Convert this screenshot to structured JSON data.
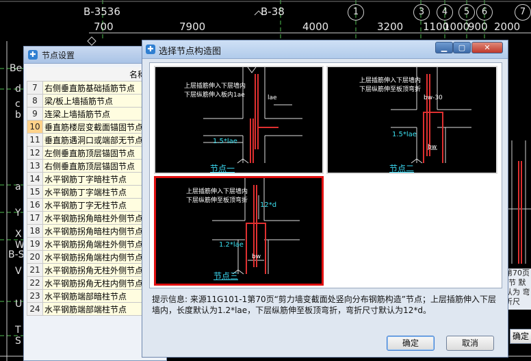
{
  "cad": {
    "axis_top": [
      "B-3536",
      "B-38",
      "1",
      "3",
      "4",
      "5",
      "6",
      "7"
    ],
    "dims": [
      "700",
      "7900",
      "4000",
      "3200",
      "1100",
      "1000",
      "900",
      "2000"
    ],
    "left_tags": [
      "Be",
      "d",
      "c",
      "b",
      "a",
      "Y",
      "X",
      "W",
      "B-S",
      "V",
      "U",
      "T",
      "S"
    ]
  },
  "node_window": {
    "title": "节点设置",
    "header": "名称",
    "rows": [
      {
        "num": "7",
        "name": "右侧垂直筋基础插筋节点"
      },
      {
        "num": "8",
        "name": "梁/板上墙插筋节点"
      },
      {
        "num": "9",
        "name": "连梁上墙插筋节点"
      },
      {
        "num": "10",
        "name": "垂直筋楼层变截面锚固节点"
      },
      {
        "num": "11",
        "name": "垂直筋遇洞口或端部无节点"
      },
      {
        "num": "12",
        "name": "左侧垂直筋顶层锚固节点"
      },
      {
        "num": "13",
        "name": "右侧垂直筋顶层锚固节点"
      },
      {
        "num": "14",
        "name": "水平钢筋丁字暗柱节点"
      },
      {
        "num": "15",
        "name": "水平钢筋丁字端柱节点"
      },
      {
        "num": "16",
        "name": "水平钢筋丁字无柱节点"
      },
      {
        "num": "17",
        "name": "水平钢筋拐角暗柱外侧节点"
      },
      {
        "num": "18",
        "name": "水平钢筋拐角暗柱内侧节点"
      },
      {
        "num": "19",
        "name": "水平钢筋拐角端柱外侧节点"
      },
      {
        "num": "20",
        "name": "水平钢筋拐角端柱内侧节点"
      },
      {
        "num": "21",
        "name": "水平钢筋拐角无柱外侧节点"
      },
      {
        "num": "22",
        "name": "水平钢筋拐角无柱内侧节点"
      },
      {
        "num": "23",
        "name": "水平钢筋端部暗柱节点"
      },
      {
        "num": "24",
        "name": "水平钢筋端部端柱节点"
      }
    ]
  },
  "dialog": {
    "title": "选择节点构造图",
    "nodes": [
      {
        "label": "节点一",
        "note1": "上层插筋伸入下层墙内",
        "note2": "下层纵筋伸入板内1ae",
        "dim_a": "lae",
        "dim_b": "1.5*lae"
      },
      {
        "label": "节点二",
        "note1": "上层插筋伸入下层墙内",
        "note2": "下层纵筋伸至板顶弯折",
        "dim_a": "bw-30",
        "dim_b": "1.5*lae",
        "dim_c": "bw"
      },
      {
        "label": "节点三",
        "note1": "上层插筋伸入下层墙内",
        "note2": "下层纵筋伸至板顶弯折",
        "dim_a": "12*d",
        "dim_b": "1.2*lae",
        "dim_c": "bw"
      }
    ],
    "info_label": "提示信息:",
    "info_text": "来源11G101-1第70页“剪力墙变截面处竖向分布钢筋构造”节点；上层插筋伸入下层墙内，长度默认为1.2*lae，下层纵筋伸至板顶弯折，弯折尺寸默认为12*d。",
    "ok": "确定",
    "cancel": "取消"
  },
  "right_window": {
    "ok": "确定",
    "snippet": "第70页 \"节 默认为 弯折尺"
  }
}
